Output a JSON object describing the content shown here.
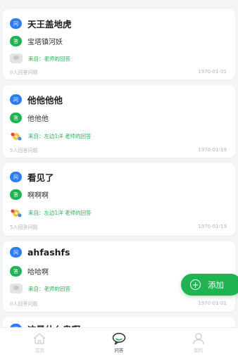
{
  "badges": {
    "question": "问",
    "answer": "答"
  },
  "cards": [
    {
      "question": "天王盖地虎",
      "answer": "宝塔镇河妖",
      "source": "来自：老师的回答",
      "avatar": "gray-avatar",
      "answers_count": "0人回答问题",
      "date": "1970-01-01"
    },
    {
      "question": "他他他他",
      "answer": "他他他",
      "source": "来自：左边1洋 老师的回答",
      "avatar": "cartoon-avatar",
      "answers_count": "5人回答问题",
      "date": "1970-01-19"
    },
    {
      "question": "看见了",
      "answer": "啊啊啊",
      "source": "来自：左边1洋 老师的回答",
      "avatar": "cartoon-avatar",
      "answers_count": "5人回答问题",
      "date": "1970-01-19"
    },
    {
      "question": "ahfashfs",
      "answer": "哈哈啊",
      "source": "来自：老师的回答",
      "avatar": "gray-avatar",
      "answers_count": "0人回答问题",
      "date": "1970-01-01"
    },
    {
      "question": "这是什么鬼啊"
    }
  ],
  "fab": {
    "label": "添加",
    "icon": "plus-circle-icon"
  },
  "tabbar": {
    "items": [
      {
        "label": "首页",
        "icon": "home-icon",
        "active": false
      },
      {
        "label": "问答",
        "icon": "chat-bubble-icon",
        "active": true
      },
      {
        "label": "我的",
        "icon": "user-icon",
        "active": false
      }
    ]
  },
  "colors": {
    "accent": "#20b352",
    "question_badge": "#2f7df6",
    "background": "#f3f4f6",
    "muted_text": "#b6b6b6"
  }
}
